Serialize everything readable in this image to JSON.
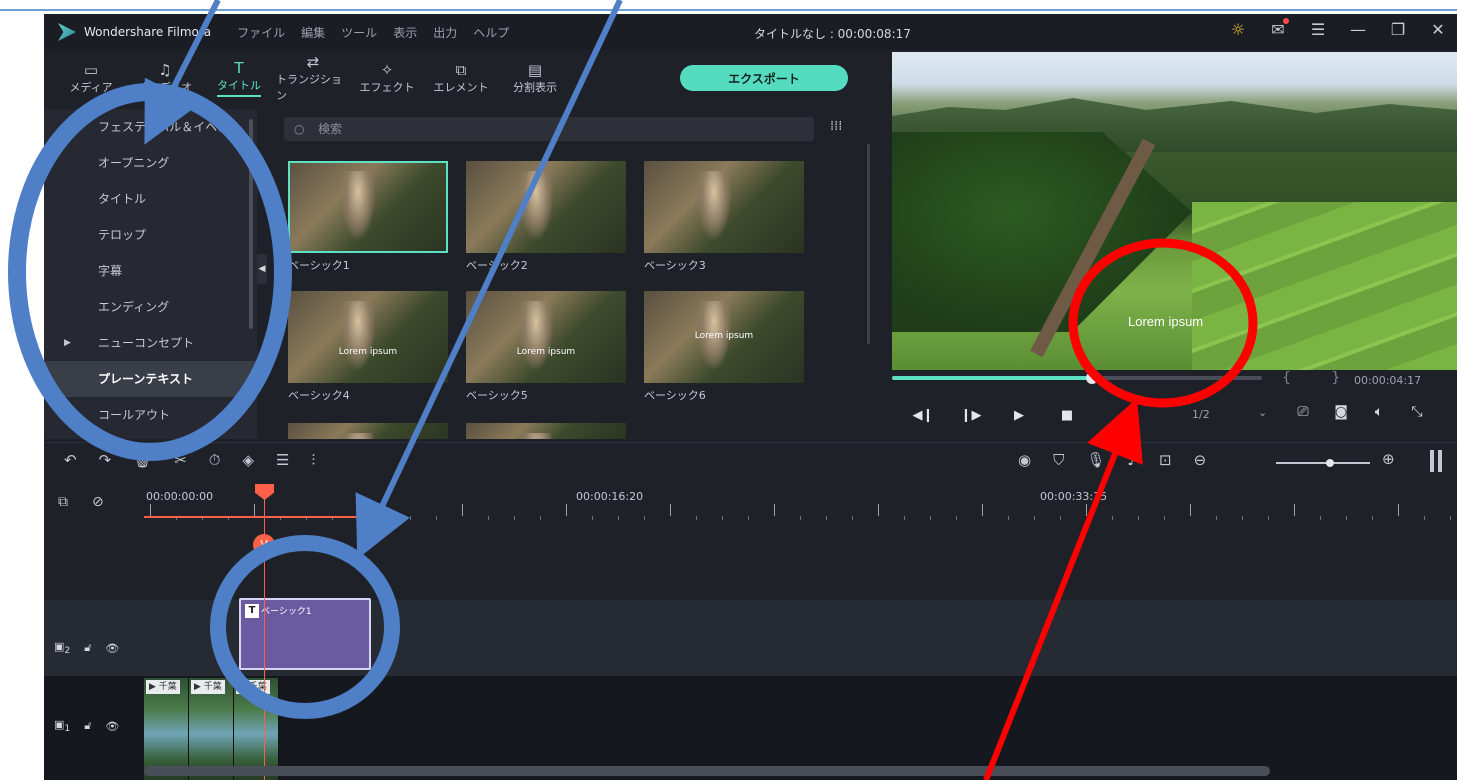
{
  "app": {
    "name": "Wondershare Filmora",
    "window_title": "タイトルなし : 00:00:08:17",
    "menus": [
      "ファイル",
      "編集",
      "ツール",
      "表示",
      "出力",
      "ヘルプ"
    ]
  },
  "toolbar": {
    "tabs": [
      {
        "label": "メディア",
        "icon": "folder-icon"
      },
      {
        "label": "オーディオ",
        "icon": "music-icon"
      },
      {
        "label": "タイトル",
        "icon": "text-icon",
        "active": true
      },
      {
        "label": "トランジション",
        "icon": "transition-icon"
      },
      {
        "label": "エフェクト",
        "icon": "effect-icon"
      },
      {
        "label": "エレメント",
        "icon": "element-icon"
      },
      {
        "label": "分割表示",
        "icon": "split-icon"
      }
    ],
    "export_label": "エクスポート"
  },
  "categories": [
    {
      "label": "フェスティバル＆イベン"
    },
    {
      "label": "オープニング"
    },
    {
      "label": "タイトル"
    },
    {
      "label": "テロップ"
    },
    {
      "label": "字幕"
    },
    {
      "label": "エンディング"
    },
    {
      "label": "ニューコンセプト",
      "expandable": true
    },
    {
      "label": "プレーンテキスト",
      "selected": true
    },
    {
      "label": "コールアウト"
    }
  ],
  "search": {
    "placeholder": "検索"
  },
  "thumbnails": [
    {
      "label": "ベーシック1",
      "overlay": ""
    },
    {
      "label": "ベーシック2",
      "overlay": ""
    },
    {
      "label": "ベーシック3",
      "overlay": ""
    },
    {
      "label": "ベーシック4",
      "overlay": "Lorem ipsum"
    },
    {
      "label": "ベーシック5",
      "overlay": "Lorem ipsum"
    },
    {
      "label": "ベーシック6",
      "overlay": "Lorem ipsum"
    }
  ],
  "preview": {
    "caption": "Lorem ipsum",
    "time": "00:00:04:17",
    "progress": 0.54,
    "braces": "{ }",
    "ratio": "1/2"
  },
  "timeline": {
    "ruler_times": [
      "00:00:00:00",
      "00:00:16:20",
      "00:00:33:15"
    ],
    "playhead_marker": "V",
    "title_clip": "ベーシック1",
    "video_clip_label": "千葉",
    "tracks": [
      {
        "number": "2"
      },
      {
        "number": "1"
      }
    ]
  },
  "colors": {
    "accent": "#5ce1c4",
    "playhead": "#ff6048",
    "annotation_blue": "#4f7fc6",
    "annotation_red": "#ff0000"
  }
}
